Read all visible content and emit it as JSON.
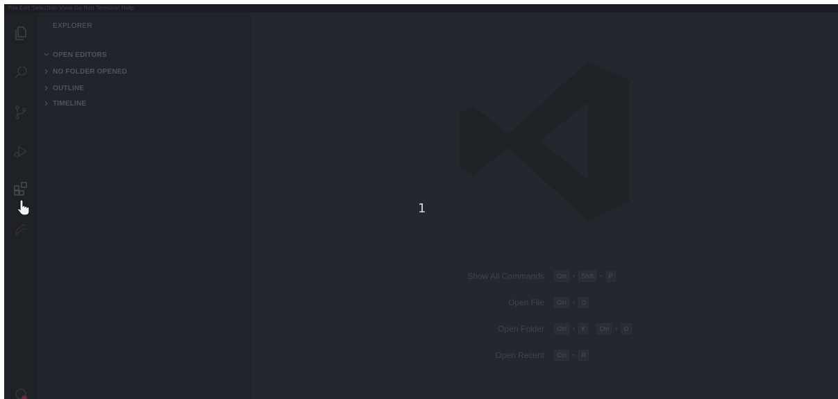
{
  "titlebar": {
    "text": "File  Edit  Selection  View  Go  Run  Terminal  Help"
  },
  "activitybar": {
    "items": [
      {
        "icon": "files-icon"
      },
      {
        "icon": "search-icon"
      },
      {
        "icon": "source-control-icon"
      },
      {
        "icon": "run-debug-icon"
      },
      {
        "icon": "extensions-icon"
      },
      {
        "icon": "remote-explorer-icon"
      }
    ],
    "bottom": [
      {
        "icon": "account-icon"
      }
    ]
  },
  "sidebar": {
    "title": "EXPLORER",
    "sections": [
      {
        "label": "OPEN EDITORS",
        "expanded": true
      },
      {
        "label": "NO FOLDER OPENED",
        "expanded": false
      },
      {
        "label": "OUTLINE",
        "expanded": false
      },
      {
        "label": "TIMELINE",
        "expanded": false
      }
    ]
  },
  "editor": {
    "marker": "1",
    "shortcuts": [
      {
        "label": "Show All Commands",
        "keys": [
          [
            "Ctrl",
            "Shift",
            "P"
          ]
        ]
      },
      {
        "label": "Open File",
        "keys": [
          [
            "Ctrl",
            "O"
          ]
        ]
      },
      {
        "label": "Open Folder",
        "keys": [
          [
            "Ctrl",
            "K"
          ],
          [
            "Ctrl",
            "O"
          ]
        ]
      },
      {
        "label": "Open Recent",
        "keys": [
          [
            "Ctrl",
            "R"
          ]
        ]
      }
    ]
  },
  "colors": {
    "window_bg": "#22252c",
    "activitybar_bg": "#1e2126",
    "sidebar_bg": "#21242a",
    "editor_bg": "#24272e",
    "icon": "#3a3d44",
    "accent": "#7a2a4a"
  }
}
